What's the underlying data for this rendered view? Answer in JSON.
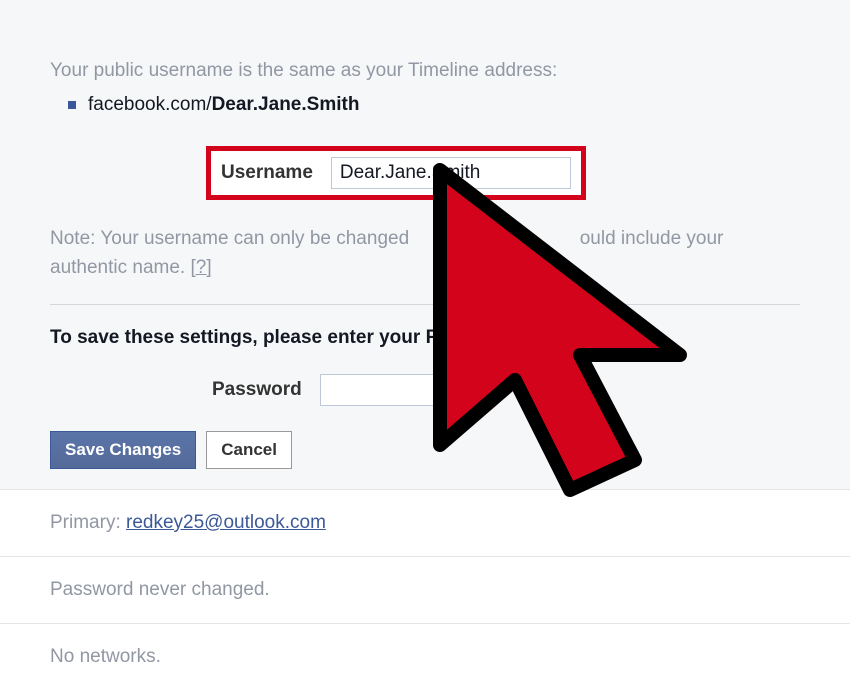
{
  "intro": "Your public username is the same as your Timeline address:",
  "url_prefix": "facebook.com/",
  "url_username": "Dear.Jane.Smith",
  "username": {
    "label": "Username",
    "value": "Dear.Jane.Smith"
  },
  "note": {
    "text_before": "Note: Your username can only be changed ",
    "text_gap": "",
    "text_after": "ould include your authentic name. ",
    "help": "[?]"
  },
  "save_prompt": "To save these settings, please enter your Fa",
  "password": {
    "label": "Password",
    "value": ""
  },
  "buttons": {
    "save": "Save Changes",
    "cancel": "Cancel"
  },
  "primary_label": "Primary: ",
  "primary_email": "redkey25@outlook.com",
  "password_status": "Password never changed.",
  "networks_status": "No networks."
}
